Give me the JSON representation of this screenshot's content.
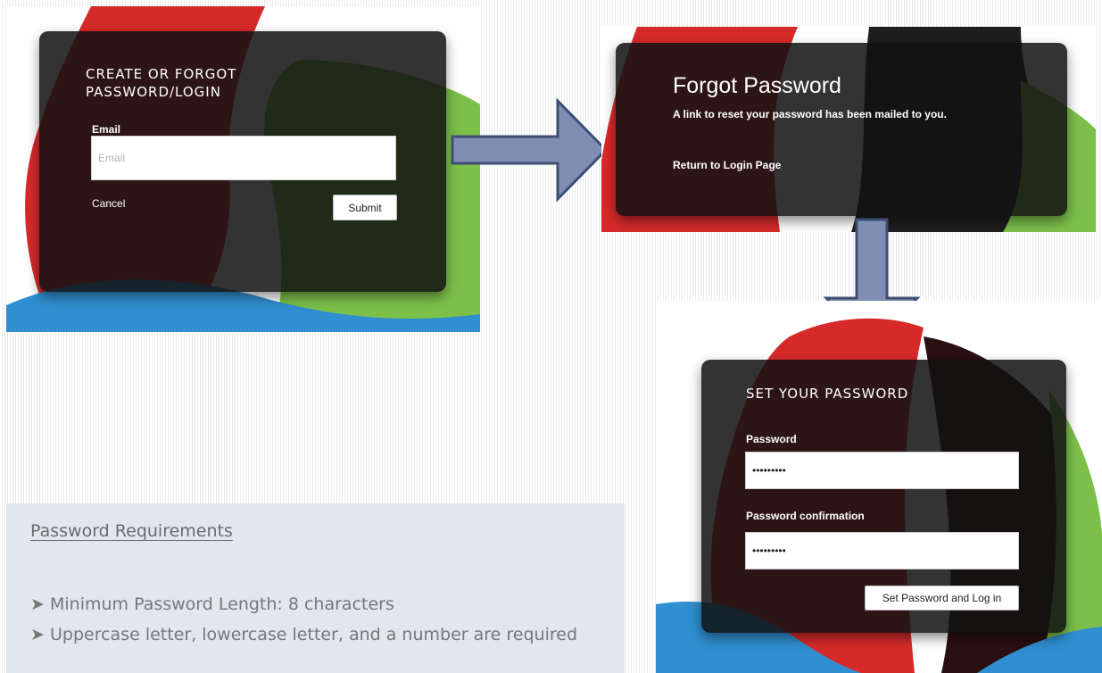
{
  "screen1": {
    "title_line1": "CREATE OR FORGOT",
    "title_line2": "PASSWORD/LOGIN",
    "email_label": "Email",
    "email_placeholder": "Email",
    "cancel_label": "Cancel",
    "submit_label": "Submit"
  },
  "screen2": {
    "title": "Forgot Password",
    "message": "A link to reset your password has been mailed to you.",
    "return_link": "Return to Login Page"
  },
  "screen3": {
    "title": "SET YOUR PASSWORD",
    "password_label": "Password",
    "password_value": "•••••••••",
    "confirmation_label": "Password confirmation",
    "confirmation_value": "•••••••••",
    "submit_label": "Set Password and Log in"
  },
  "requirements": {
    "title": "Password Requirements",
    "items": [
      "Minimum Password Length: 8 characters",
      "Uppercase letter, lowercase letter, and a number are required"
    ]
  },
  "colors": {
    "arrow_fill": "#7f8fb3",
    "arrow_stroke": "#3f4f73",
    "card_bg": "#121212",
    "blob_red": "#d62a2a",
    "blob_green": "#7cc04a",
    "blob_blue": "#2f8fd0"
  }
}
